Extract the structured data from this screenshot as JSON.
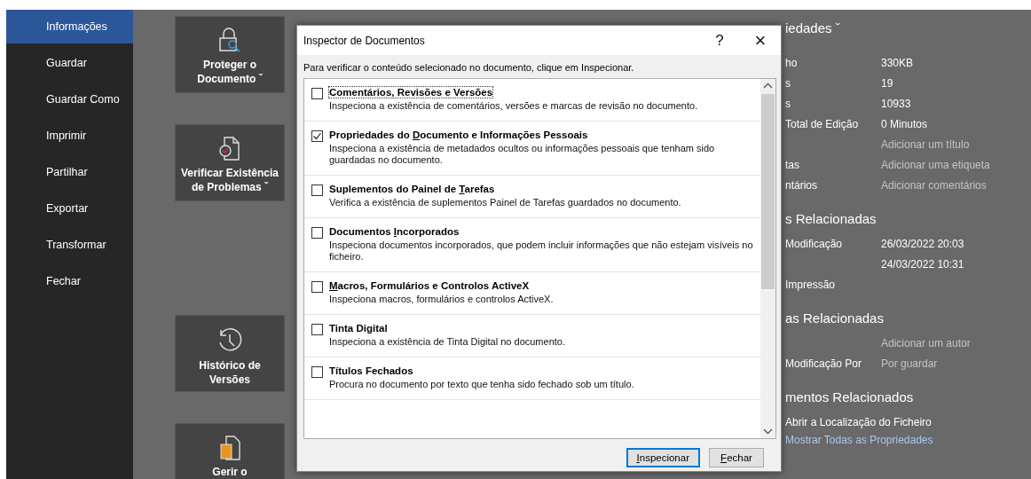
{
  "sidebar": {
    "items": [
      {
        "label": "Informações",
        "selected": true
      },
      {
        "label": "Guardar",
        "selected": false
      },
      {
        "label": "Guardar Como",
        "selected": false
      },
      {
        "label": "Imprimir",
        "selected": false
      },
      {
        "label": "Partilhar",
        "selected": false
      },
      {
        "label": "Exportar",
        "selected": false
      },
      {
        "label": "Transformar",
        "selected": false
      },
      {
        "label": "Fechar",
        "selected": false
      }
    ]
  },
  "tools": [
    {
      "kind": "lock",
      "lines": [
        "Proteger o",
        "Documento ˇ"
      ]
    },
    {
      "kind": "check",
      "lines": [
        "Verificar Existência",
        "de Problemas ˇ"
      ]
    },
    {
      "kind": "gap"
    },
    {
      "kind": "history",
      "lines": [
        "Histórico de",
        "Versões"
      ]
    },
    {
      "kind": "manage",
      "lines": [
        "Gerir o"
      ]
    }
  ],
  "properties": {
    "heading": "iedades ˇ",
    "rows": [
      {
        "label": "ho",
        "value": "330KB",
        "placeholder": false
      },
      {
        "label": "s",
        "value": "19",
        "placeholder": false
      },
      {
        "label": "s",
        "value": "10933",
        "placeholder": false
      },
      {
        "label": "Total de Edição",
        "value": "0 Minutos",
        "placeholder": false
      },
      {
        "value": "Adicionar um título",
        "placeholder": true
      },
      {
        "label": "tas",
        "value": "Adicionar uma etiqueta",
        "placeholder": true
      },
      {
        "label": "ntários",
        "value": "Adicionar comentários",
        "placeholder": true
      }
    ],
    "sections": [
      {
        "heading": "s Relacionadas",
        "rows": [
          {
            "label": "Modificação",
            "value": "26/03/2022 20:03",
            "placeholder": false
          },
          {
            "value": "24/03/2022 10:31",
            "placeholder": false
          },
          {
            "label": "Impressão"
          }
        ]
      },
      {
        "heading": "as Relacionadas",
        "rows": [
          {
            "value": "Adicionar um autor",
            "placeholder": true
          },
          {
            "label": "Modificação Por",
            "value": "Por guardar",
            "placeholder": true
          }
        ]
      },
      {
        "heading": "mentos Relacionados",
        "rows": [
          {
            "label": "Abrir a Localização do Ficheiro"
          }
        ]
      }
    ],
    "link": "Mostrar Todas as Propriedades"
  },
  "dialog": {
    "title": "Inspector de Documentos",
    "help": "?",
    "close": "×",
    "instruction": "Para verificar o conteúdo selecionado no documento, clique em Inspecionar.",
    "items": [
      {
        "title": [
          {
            "text": "Comentários, Revisões e Versões",
            "underline": false
          }
        ],
        "description": "Inspeciona a existência de comentários, versões e marcas de revisão no documento.",
        "checked": false,
        "focused": true
      },
      {
        "title": [
          {
            "text": "Propriedades do ",
            "underline": false
          },
          {
            "text": "D",
            "underline": true
          },
          {
            "text": "ocumento e Informações Pessoais",
            "underline": false
          }
        ],
        "description": "Inspeciona a existência de metadados ocultos ou informações pessoais que tenham sido guardadas no documento.",
        "checked": true,
        "focused": false
      },
      {
        "title": [
          {
            "text": "Suplementos do Painel de ",
            "underline": false
          },
          {
            "text": "T",
            "underline": true
          },
          {
            "text": "arefas",
            "underline": false
          }
        ],
        "description": "Verifica a existência de suplementos Painel de Tarefas guardados no documento.",
        "checked": false,
        "focused": false
      },
      {
        "title": [
          {
            "text": "Documentos ",
            "underline": false
          },
          {
            "text": "I",
            "underline": true
          },
          {
            "text": "ncorporados",
            "underline": false
          }
        ],
        "description": "Inspeciona documentos incorporados, que podem incluir informações que não estejam visíveis no ficheiro.",
        "checked": false,
        "focused": false
      },
      {
        "title": [
          {
            "text": "M",
            "underline": true
          },
          {
            "text": "acros, Formulários e Controlos ActiveX",
            "underline": false
          }
        ],
        "description": "Inspeciona macros, formulários e controlos ActiveX.",
        "checked": false,
        "focused": false
      },
      {
        "title": [
          {
            "text": "Tinta Digital",
            "underline": false
          }
        ],
        "description": "Inspeciona a existência de Tinta Digital no documento.",
        "checked": false,
        "focused": false
      },
      {
        "title": [
          {
            "text": "Títulos Fechados",
            "underline": false
          }
        ],
        "description": "Procura no documento por texto que tenha sido fechado sob um título.",
        "checked": false,
        "focused": false
      }
    ],
    "buttons": [
      {
        "label": [
          {
            "text": "I",
            "underline": true
          },
          {
            "text": "nspecionar",
            "underline": false
          }
        ],
        "selected": true
      },
      {
        "label": [
          {
            "text": "F",
            "underline": true
          },
          {
            "text": "echar",
            "underline": false
          }
        ],
        "selected": false
      }
    ]
  }
}
